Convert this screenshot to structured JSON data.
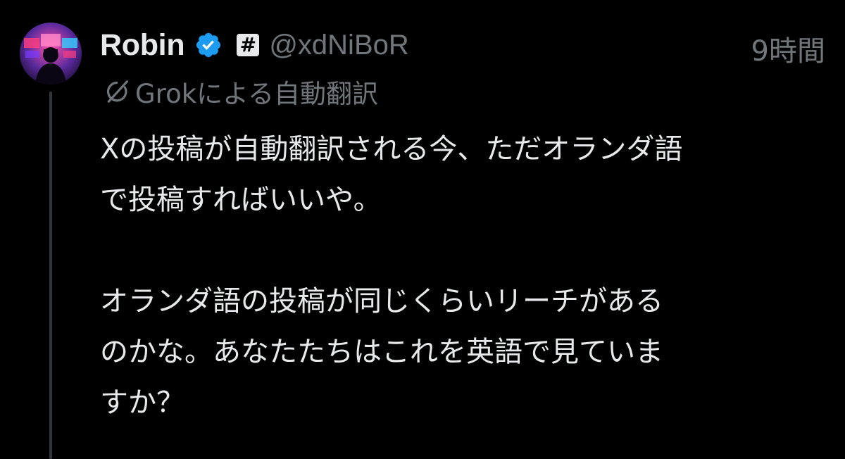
{
  "author": {
    "display_name": "Robin",
    "handle": "@xdNiBoR",
    "verified_icon": "verified-badge-icon",
    "affiliate_badge": "#"
  },
  "timestamp": "9時間",
  "translation": {
    "icon": "grok-icon",
    "label": "Grokによる自動翻訳"
  },
  "body": {
    "lines": [
      "Xの投稿が自動翻訳される今、ただオランダ語",
      "で投稿すればいいや。",
      "",
      "オランダ語の投稿が同じくらいリーチがある",
      "のかな。あなたたちはこれを英語で見ていま",
      "すか？"
    ]
  },
  "colors": {
    "background": "#000000",
    "primary_text": "#e7e9ea",
    "secondary_text": "#71767b",
    "verified_blue": "#1d9bf0",
    "thread_line": "#333639"
  }
}
